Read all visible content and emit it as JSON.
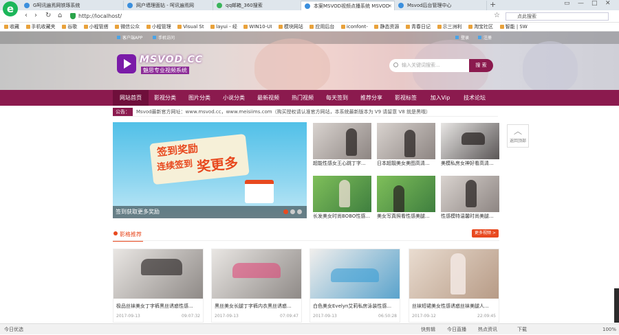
{
  "browser": {
    "tabs": [
      {
        "label": "G呵讯遍焉网铁琢系统"
      },
      {
        "label": "网户墙理面钻 - 呵讯遍焉网"
      },
      {
        "label": "qq邮箱_360搜索"
      },
      {
        "label": "本案MSVOD视频点播系统 MSVOD"
      },
      {
        "label": "Msvod后台管理中心"
      }
    ],
    "new_tab": "+",
    "window_controls": [
      "▭",
      "—",
      "□",
      "✕"
    ],
    "nav": {
      "back": "‹",
      "forward": "›",
      "reload": "↻",
      "home": "⌂",
      "star": "☆"
    },
    "url": "http://localhost/",
    "search_placeholder": "点此搜索",
    "bookmarks": [
      "收藏",
      "手机收藏夹",
      "谷歌",
      "小程管搭",
      "微信公众",
      "小程管理",
      "Visual St",
      "layui - 经",
      "WIN10-UI",
      "模块网站",
      "应用后台",
      "iconfont-",
      "静态资源",
      "青春日记",
      "示三洲利",
      "淘宝社区",
      "智能 | SW"
    ]
  },
  "site": {
    "top_links": [
      "客户端APP",
      "手机访问"
    ],
    "top_right": [
      "登录",
      "注册"
    ],
    "logo_text": "MSVOD.CC",
    "logo_sub": "魅思专业视频系统",
    "search_placeholder": "输入关键词搜索...",
    "search_button": "搜 索",
    "nav": [
      "网站首页",
      "影视分类",
      "图片分类",
      "小说分类",
      "最新视频",
      "热门视频",
      "每天签到",
      "推荐分享",
      "影视标签",
      "加入Vip",
      "技术论坛"
    ],
    "notice_tag": "公告：",
    "notice_text": "Msvod最新官方网址：www.msvod.cc，www.meisiims.com（购买授权请认准官方网站，本系统最新版本为 V9 请留意 V8 就是黑哦）"
  },
  "banner": {
    "line1": "签到奖励",
    "line2": "连续签到",
    "line3": "奖更多",
    "caption": "签到获取更多奖励"
  },
  "thumbs": [
    {
      "caption": "超能性感女王心跳丁字..."
    },
    {
      "caption": "日本超靓美女美图高清..."
    },
    {
      "caption": "美模私房女神好看高清..."
    },
    {
      "caption": "长发美女时尚BOBO性感..."
    },
    {
      "caption": "美女写真照看性感美腿..."
    },
    {
      "caption": "性感模特温馨时尚美腿..."
    }
  ],
  "side": {
    "back_top": "返回顶部"
  },
  "section": {
    "title": "影格推荐",
    "more": "更多视频 >"
  },
  "cards": [
    {
      "title": "极品丝袜美女丁字裤黑丝诱惑性感...",
      "date": "2017-09-13",
      "meta_right": "09:07:32"
    },
    {
      "title": "黑丝美女长腿丁字裤内衣黑丝诱惑...",
      "date": "2017-09-13",
      "meta_right": "07:09:47"
    },
    {
      "title": "白色美女Evelyn艾莉私房泳装性感...",
      "date": "2017-09-13",
      "meta_right": "06:50:28"
    },
    {
      "title": "丝袜短裙美女性感诱惑丝袜美腿人...",
      "date": "2017-09-12",
      "meta_right": "22:09:45"
    }
  ],
  "statusbar": {
    "left": "今日优选",
    "items": [
      "快剪辑",
      "今日直播",
      "热点资讯"
    ],
    "right": [
      "下载",
      "100%"
    ]
  }
}
